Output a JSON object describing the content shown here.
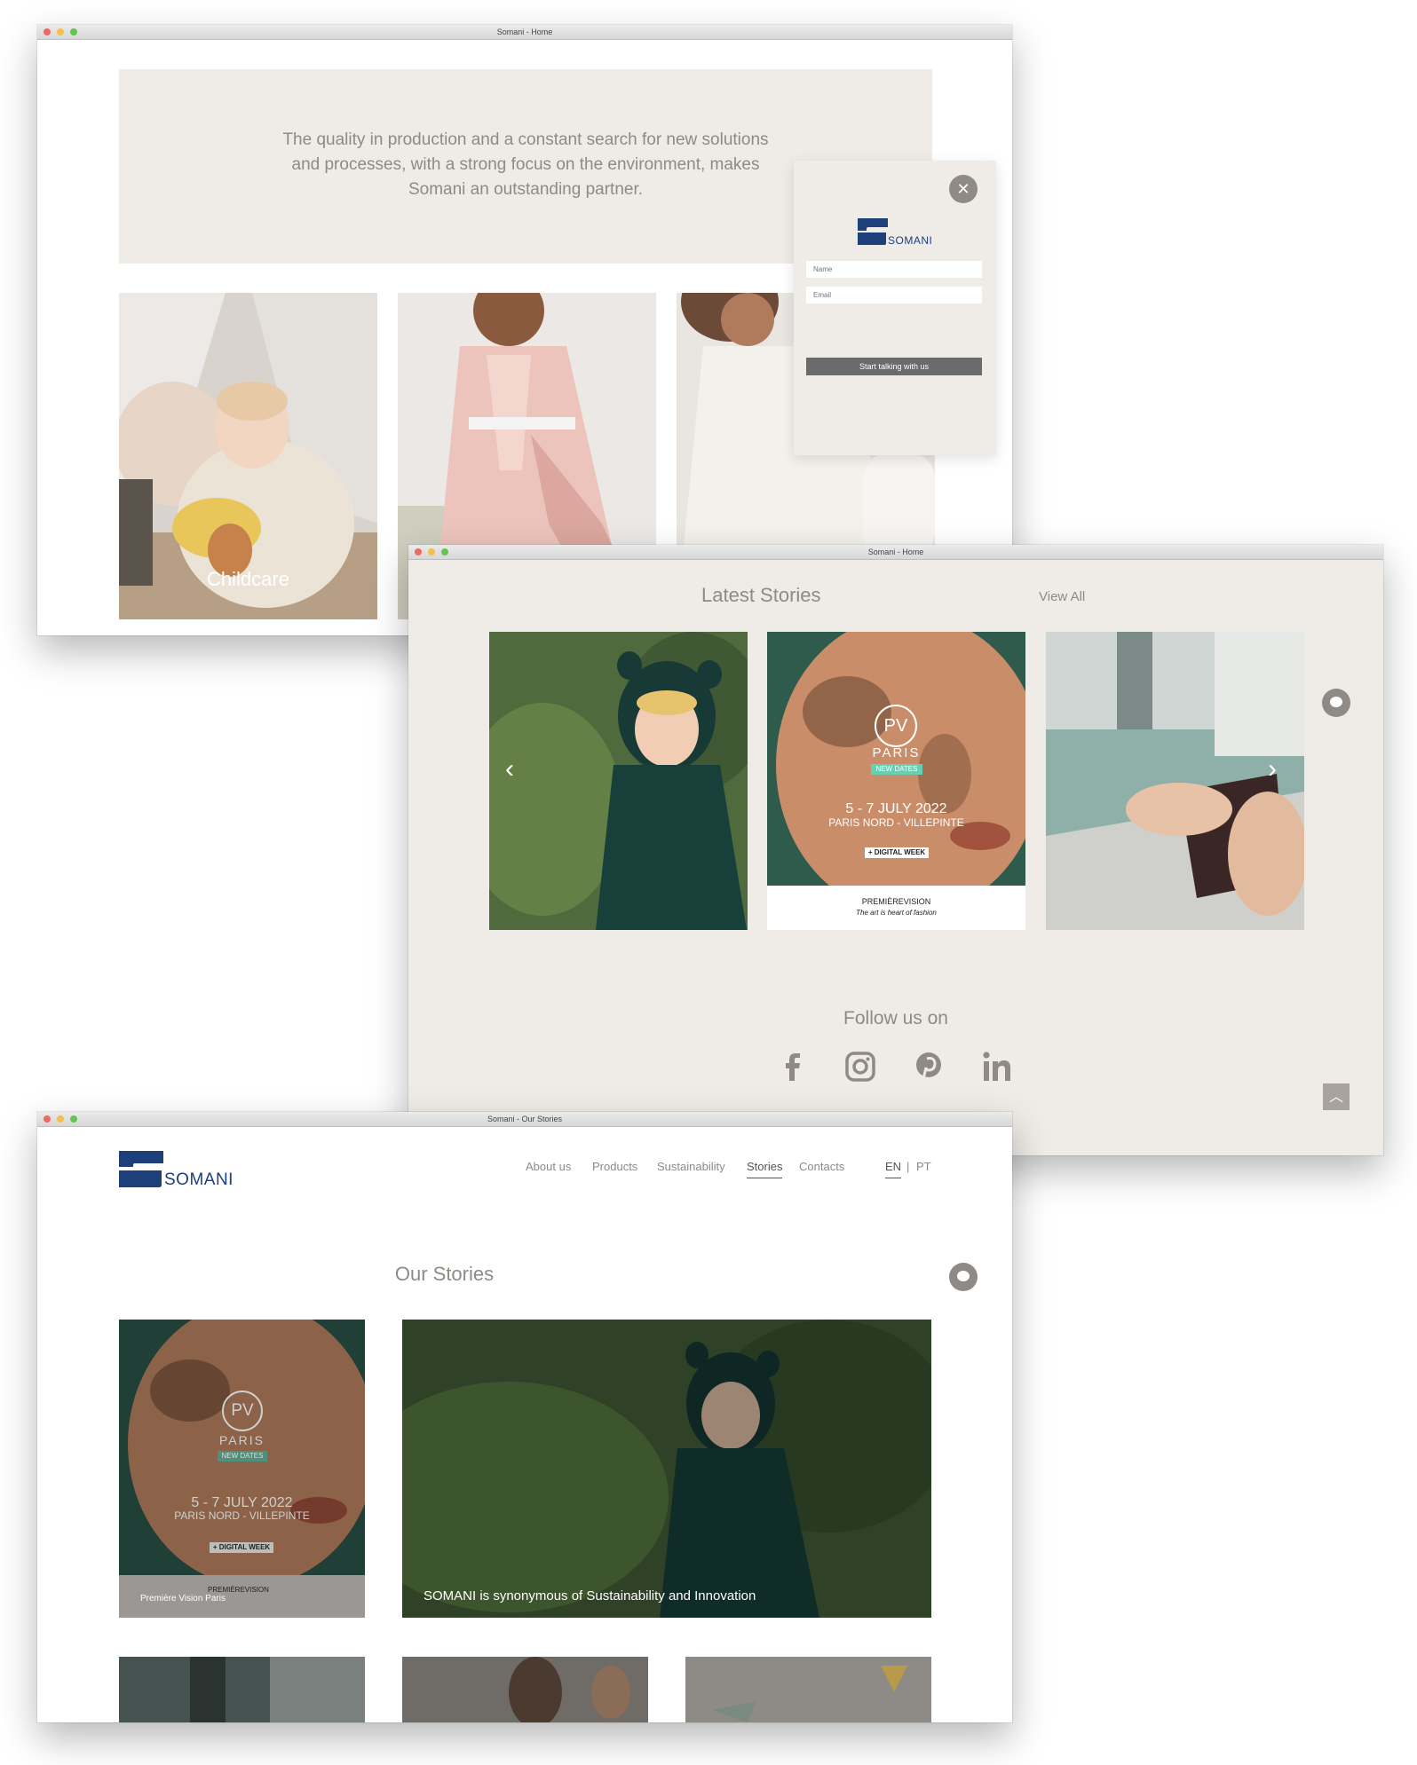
{
  "windows": {
    "home_top": {
      "title": "Somani - Home",
      "intro_text": "The quality in production and a constant search for new solutions and processes, with a strong focus on the environment, makes Somani an outstanding partner.",
      "tiles": [
        {
          "label": "Childcare"
        }
      ],
      "popup": {
        "close_icon": "close-icon",
        "brand": "SOMANI",
        "name_placeholder": "Name",
        "email_placeholder": "Email",
        "button_label": "Start talking with us"
      }
    },
    "home_stories": {
      "title": "Somani - Home",
      "section_title": "Latest Stories",
      "view_all": "View All",
      "poster": {
        "logo_text": "PV",
        "city": "PARIS",
        "badge": "NEW DATES",
        "dates": "5 - 7 JULY 2022",
        "venue": "PARIS NORD - VILLEPINTE",
        "tag": "+ DIGITAL WEEK",
        "brand": "PREMIÈREVISION",
        "tagline": "The art is heart of fashion"
      },
      "follow_title": "Follow us on",
      "social": [
        "facebook-icon",
        "instagram-icon",
        "pinterest-icon",
        "linkedin-icon"
      ]
    },
    "our_stories": {
      "title": "Somani - Our Stories",
      "brand": "SOMANI",
      "nav": [
        "About us",
        "Products",
        "Sustainability",
        "Stories",
        "Contacts"
      ],
      "active_nav": "Stories",
      "lang_en": "EN",
      "lang_sep": "|",
      "lang_pt": "PT",
      "section_title": "Our Stories",
      "stories": [
        {
          "caption": "Première Vision Paris"
        },
        {
          "caption": "SOMANI is synonymous of Sustainability and Innovation"
        }
      ]
    }
  },
  "colors": {
    "beige": "#efebe7",
    "text_grey": "#8f8a85",
    "brand_blue": "#1d3f7a",
    "button_grey": "#6b6b6b"
  }
}
